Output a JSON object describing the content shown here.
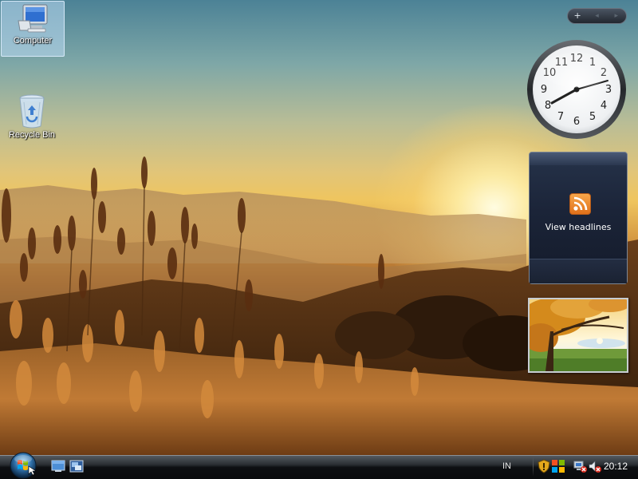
{
  "desktop": {
    "icons": [
      {
        "label": "Computer",
        "icon": "computer-icon",
        "selected": true
      },
      {
        "label": "Recycle Bin",
        "icon": "recycle-bin-icon",
        "selected": false
      }
    ]
  },
  "sidebar": {
    "controls": {
      "add": "+",
      "prev": "◂",
      "next": "▸"
    },
    "clock": {
      "numbers": [
        "12",
        "1",
        "2",
        "3",
        "4",
        "5",
        "6",
        "7",
        "8",
        "9",
        "10",
        "11"
      ],
      "time_shown": "8:12"
    },
    "feed_headlines": {
      "label": "View headlines",
      "icon": "rss-feed-icon"
    },
    "slideshow": {
      "icon": "landscape-photo"
    }
  },
  "taskbar": {
    "start_button": "windows-orb-icon",
    "quick_launch": [
      "show-desktop-icon",
      "switch-windows-icon"
    ],
    "tray": {
      "language": "IN",
      "icons": [
        "security-shield-icon",
        "windows-defender-icon",
        "network-disconnected-icon",
        "volume-muted-icon"
      ],
      "time": "20:12"
    }
  },
  "colors": {
    "taskbar": "#0d0f12",
    "selection": "#bedcf5",
    "feed_accent": "#f08a2a",
    "gadget_dark": "#1b2438"
  }
}
